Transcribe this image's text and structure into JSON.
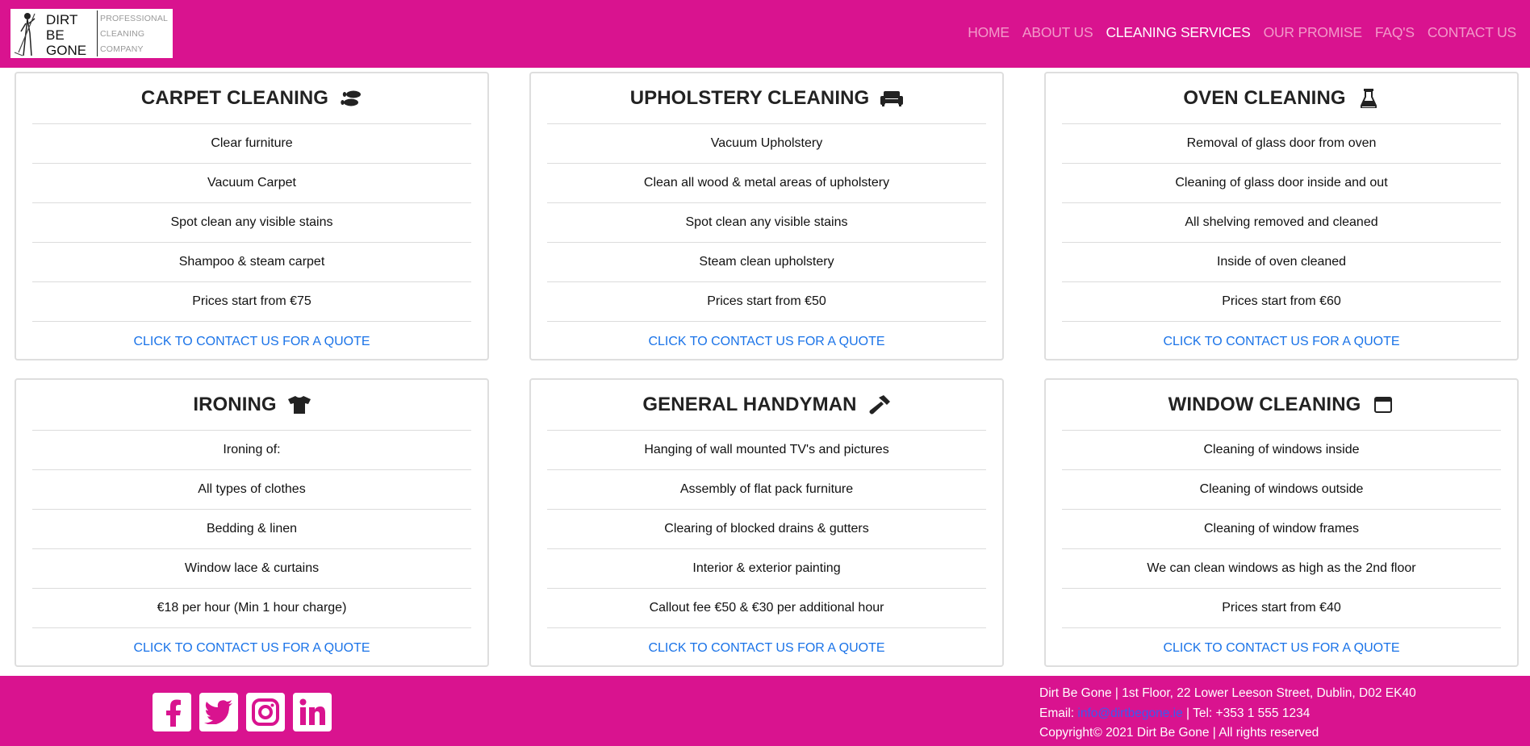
{
  "brand": {
    "name_lines": [
      "DIRT",
      "BE",
      "GONE"
    ],
    "tagline_lines": [
      "PROFESSIONAL",
      "CLEANING",
      "COMPANY"
    ],
    "color": "#d9138f"
  },
  "nav": {
    "items": [
      {
        "label": "HOME",
        "active": false
      },
      {
        "label": "ABOUT US",
        "active": false
      },
      {
        "label": "CLEANING SERVICES",
        "active": true
      },
      {
        "label": "OUR PROMISE",
        "active": false
      },
      {
        "label": "FAQ'S",
        "active": false
      },
      {
        "label": "CONTACT US",
        "active": false
      }
    ]
  },
  "services": [
    {
      "title": "CARPET CLEANING",
      "icon": "shoe-prints-icon",
      "items": [
        "Clear furniture",
        "Vacuum Carpet",
        "Spot clean any visible stains",
        "Shampoo & steam carpet",
        "Prices start from €75"
      ],
      "link": "CLICK TO CONTACT US FOR A QUOTE"
    },
    {
      "title": "UPHOLSTERY CLEANING",
      "icon": "couch-icon",
      "items": [
        "Vacuum Upholstery",
        "Clean all wood & metal areas of upholstery",
        "Spot clean any visible stains",
        "Steam clean upholstery",
        "Prices start from €50"
      ],
      "link": "CLICK TO CONTACT US FOR A QUOTE"
    },
    {
      "title": "OVEN CLEANING",
      "icon": "flask-icon",
      "items": [
        "Removal of glass door from oven",
        "Cleaning of glass door inside and out",
        "All shelving removed and cleaned",
        "Inside of oven cleaned",
        "Prices start from €60"
      ],
      "link": "CLICK TO CONTACT US FOR A QUOTE"
    },
    {
      "title": "IRONING",
      "icon": "tshirt-icon",
      "items": [
        "Ironing of:",
        "All types of clothes",
        "Bedding & linen",
        "Window lace & curtains",
        "€18 per hour (Min 1 hour charge)"
      ],
      "link": "CLICK TO CONTACT US FOR A QUOTE"
    },
    {
      "title": "GENERAL HANDYMAN",
      "icon": "hammer-icon",
      "items": [
        "Hanging of wall mounted TV's and pictures",
        "Assembly of flat pack furniture",
        "Clearing of blocked drains & gutters",
        "Interior & exterior painting",
        "Callout fee €50 & €30 per additional hour"
      ],
      "link": "CLICK TO CONTACT US FOR A QUOTE"
    },
    {
      "title": "WINDOW CLEANING",
      "icon": "window-icon",
      "items": [
        "Cleaning of windows inside",
        "Cleaning of windows outside",
        "Cleaning of window frames",
        "We can clean windows as high as the 2nd floor",
        "Prices start from €40"
      ],
      "link": "CLICK TO CONTACT US FOR A QUOTE"
    }
  ],
  "footer": {
    "socials": [
      "facebook-icon",
      "twitter-icon",
      "instagram-icon",
      "linkedin-icon"
    ],
    "address": "Dirt Be Gone | 1st Floor, 22 Lower Leeson Street, Dublin, D02 EK40",
    "email_label": "Email: ",
    "email": "info@dirtbegone.ie",
    "tel": " | Tel: +353 1 555 1234",
    "copyright": "Copyright© 2021 Dirt Be Gone | All rights reserved"
  }
}
